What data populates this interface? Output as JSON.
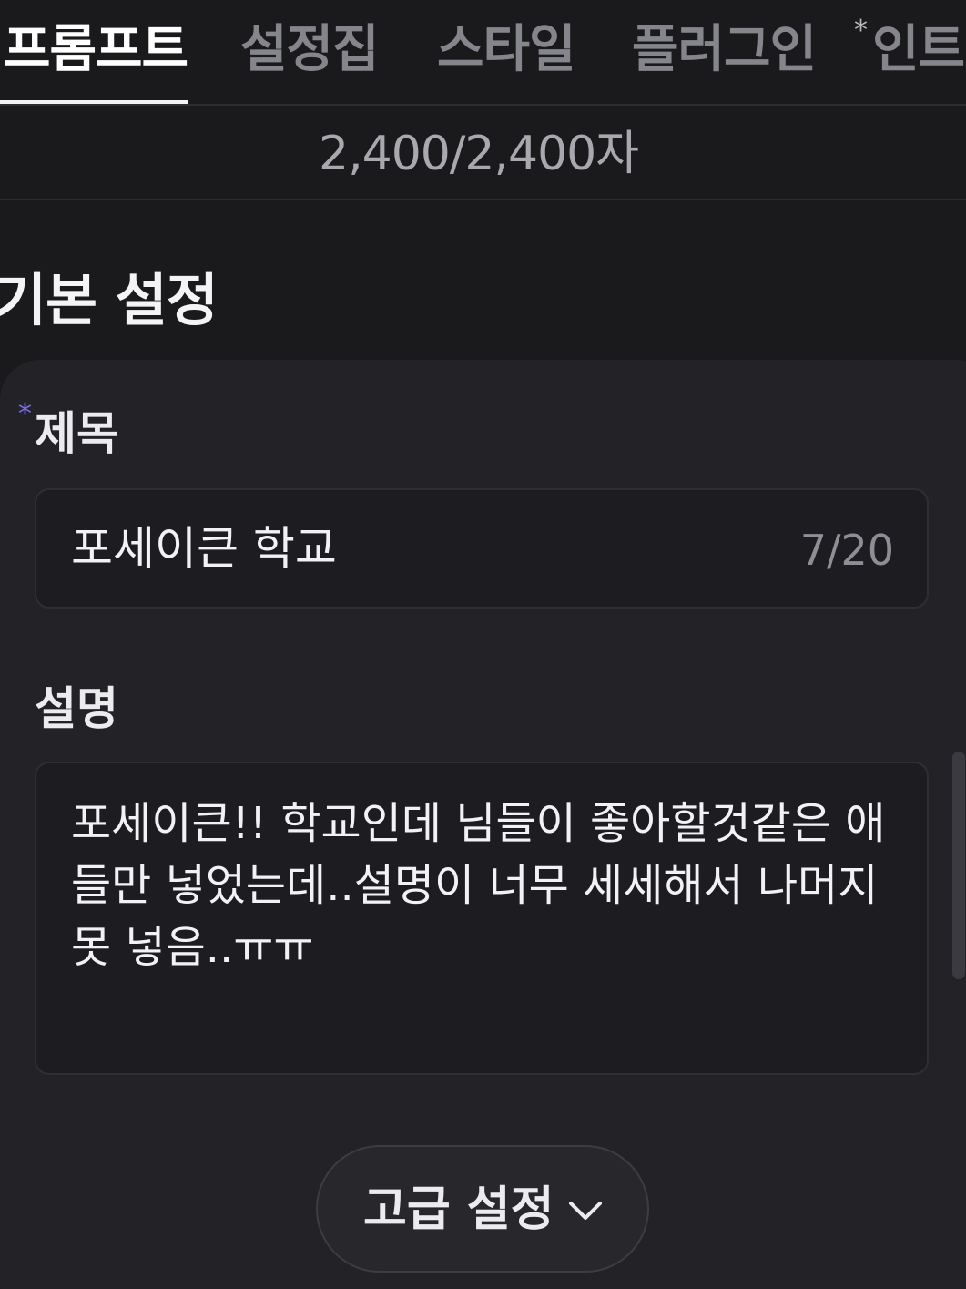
{
  "tabs": [
    {
      "label": "프롬프트",
      "active": true
    },
    {
      "label": "설정집",
      "active": false
    },
    {
      "label": "스타일",
      "active": false
    },
    {
      "label": "플러그인",
      "active": false
    },
    {
      "label": "인트로",
      "active": false,
      "required_mark": "*"
    }
  ],
  "counter": "2,400/2,400자",
  "section": {
    "title": "기본 설정"
  },
  "title_field": {
    "required_mark": "*",
    "label": "제목",
    "value": "포세이큰 학교",
    "count": "7/20"
  },
  "description_field": {
    "label": "설명",
    "value": "포세이큰!! 학교인데 님들이 좋아할것같은 애들만 넣었는데..설명이 너무 세세해서 나머지 못 넣음..ㅠㅠ"
  },
  "advanced_button": {
    "label": "고급 설정"
  },
  "colors": {
    "background": "#1a1a1d",
    "card": "#232327",
    "accent_required": "#7b6cf0"
  }
}
